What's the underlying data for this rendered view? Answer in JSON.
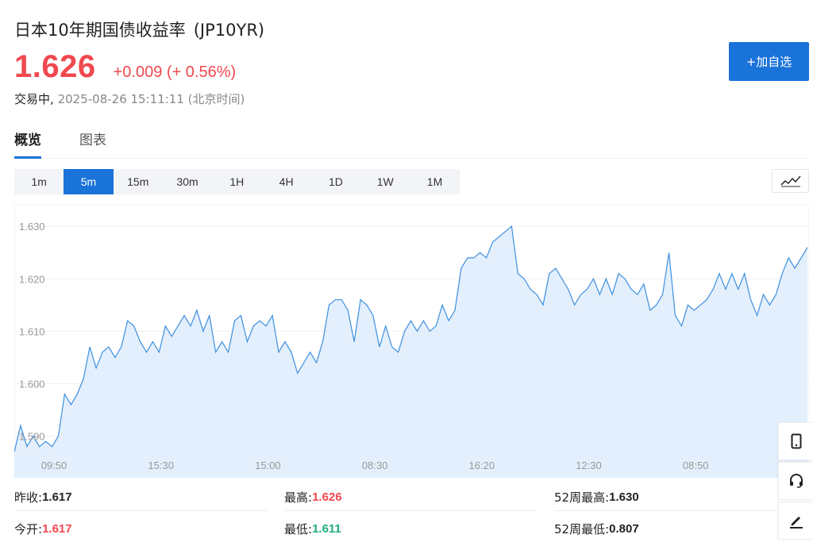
{
  "header": {
    "name": "日本10年期国债收益率",
    "code": "(JP10YR)",
    "price": "1.626",
    "change": "+0.009",
    "change_pct": "(+ 0.56%)",
    "status": "交易中,",
    "datetime": "2025-08-26 15:11:11",
    "timezone": "(北京时间)",
    "add_watchlist": "+加自选"
  },
  "colors": {
    "up": "#f0484f",
    "down": "#1fae78",
    "accent": "#1a73d9",
    "area": "#e3effc",
    "line": "#3d8fe0"
  },
  "tabs": [
    {
      "label": "概览",
      "active": true
    },
    {
      "label": "图表",
      "active": false
    }
  ],
  "periods": [
    {
      "label": "1m",
      "active": false
    },
    {
      "label": "5m",
      "active": true
    },
    {
      "label": "15m",
      "active": false
    },
    {
      "label": "30m",
      "active": false
    },
    {
      "label": "1H",
      "active": false
    },
    {
      "label": "4H",
      "active": false
    },
    {
      "label": "1D",
      "active": false
    },
    {
      "label": "1W",
      "active": false
    },
    {
      "label": "1M",
      "active": false
    }
  ],
  "chart_data": {
    "type": "area",
    "ylim": [
      1.586,
      1.632
    ],
    "y_ticks": [
      "1.590",
      "1.600",
      "1.610",
      "1.620",
      "1.630"
    ],
    "x_ticks": [
      "09:50",
      "15:30",
      "15:00",
      "08:30",
      "16:20",
      "12:30",
      "08:50"
    ],
    "values": [
      1.587,
      1.592,
      1.588,
      1.59,
      1.588,
      1.589,
      1.588,
      1.59,
      1.598,
      1.596,
      1.598,
      1.601,
      1.607,
      1.603,
      1.606,
      1.607,
      1.605,
      1.607,
      1.612,
      1.611,
      1.608,
      1.606,
      1.608,
      1.606,
      1.611,
      1.609,
      1.611,
      1.613,
      1.611,
      1.614,
      1.61,
      1.613,
      1.606,
      1.608,
      1.606,
      1.612,
      1.613,
      1.608,
      1.611,
      1.612,
      1.611,
      1.613,
      1.606,
      1.608,
      1.606,
      1.602,
      1.604,
      1.606,
      1.604,
      1.608,
      1.615,
      1.616,
      1.616,
      1.614,
      1.608,
      1.616,
      1.615,
      1.613,
      1.607,
      1.611,
      1.607,
      1.606,
      1.61,
      1.612,
      1.61,
      1.612,
      1.61,
      1.611,
      1.615,
      1.612,
      1.614,
      1.622,
      1.624,
      1.624,
      1.625,
      1.624,
      1.627,
      1.628,
      1.629,
      1.63,
      1.621,
      1.62,
      1.618,
      1.617,
      1.615,
      1.621,
      1.622,
      1.62,
      1.618,
      1.615,
      1.617,
      1.618,
      1.62,
      1.617,
      1.62,
      1.617,
      1.621,
      1.62,
      1.618,
      1.617,
      1.619,
      1.614,
      1.615,
      1.617,
      1.625,
      1.613,
      1.611,
      1.615,
      1.614,
      1.615,
      1.616,
      1.618,
      1.621,
      1.618,
      1.621,
      1.618,
      1.621,
      1.616,
      1.613,
      1.617,
      1.615,
      1.617,
      1.621,
      1.624,
      1.622,
      1.624,
      1.626
    ],
    "grid": true
  },
  "stats": [
    {
      "label": "昨收:",
      "value": "1.617",
      "tone": "neutral"
    },
    {
      "label": "最高:",
      "value": "1.626",
      "tone": "up"
    },
    {
      "label": "52周最高:",
      "value": "1.630",
      "tone": "neutral"
    },
    {
      "label": "今开:",
      "value": "1.617",
      "tone": "up"
    },
    {
      "label": "最低:",
      "value": "1.611",
      "tone": "down"
    },
    {
      "label": "52周最低:",
      "value": "0.807",
      "tone": "neutral"
    }
  ],
  "side_tools": [
    "mobile-icon",
    "headset-icon",
    "pen-icon"
  ]
}
